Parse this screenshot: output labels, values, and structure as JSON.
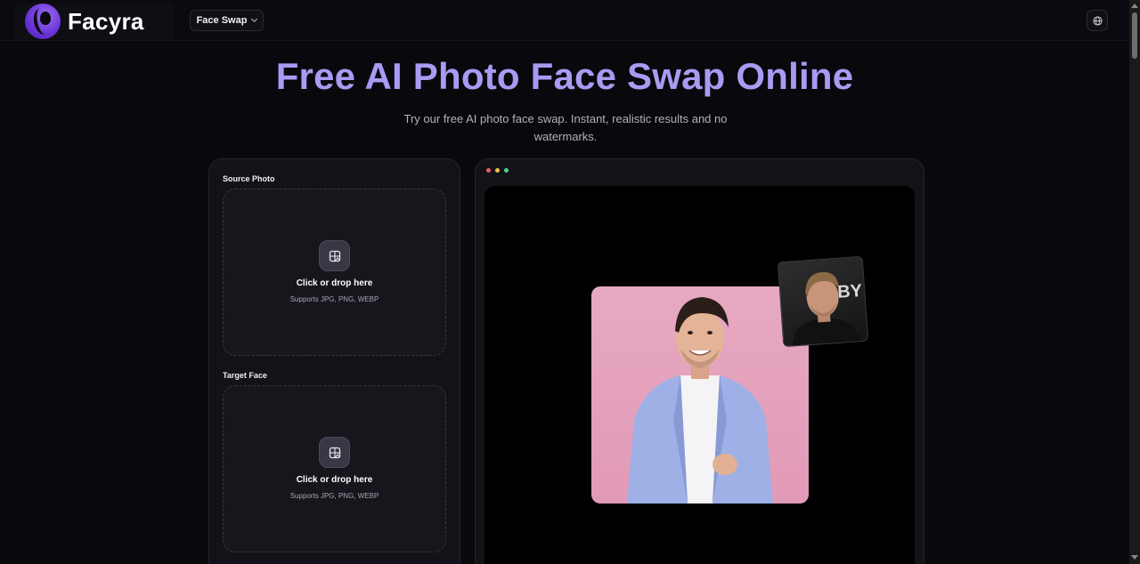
{
  "brand": {
    "name": "Facyra"
  },
  "nav": {
    "dropdown_label": "Face Swap"
  },
  "hero": {
    "title": "Free AI Photo Face Swap Online",
    "subtitle": "Try our free AI photo face swap. Instant, realistic results and no watermarks."
  },
  "upload": {
    "source": {
      "label": "Source Photo",
      "title": "Click or drop here",
      "formats": "Supports JPG, PNG, WEBP"
    },
    "target": {
      "label": "Target Face",
      "title": "Click or drop here",
      "formats": "Supports JPG, PNG, WEBP"
    }
  },
  "preview": {
    "inset_text": "BY"
  },
  "icons": {
    "logo": "woman-profile-logo-icon",
    "dropdown": "chevron-down-icon",
    "language": "globe-icon",
    "upload": "image-upload-icon"
  },
  "colors": {
    "accent": "#a89bf3",
    "logo_purple": "#6b35d8",
    "background": "#09080d",
    "panel": "#131218",
    "dot_red": "#f0596a",
    "dot_yellow": "#f3c24a",
    "dot_green": "#4fd48a"
  }
}
